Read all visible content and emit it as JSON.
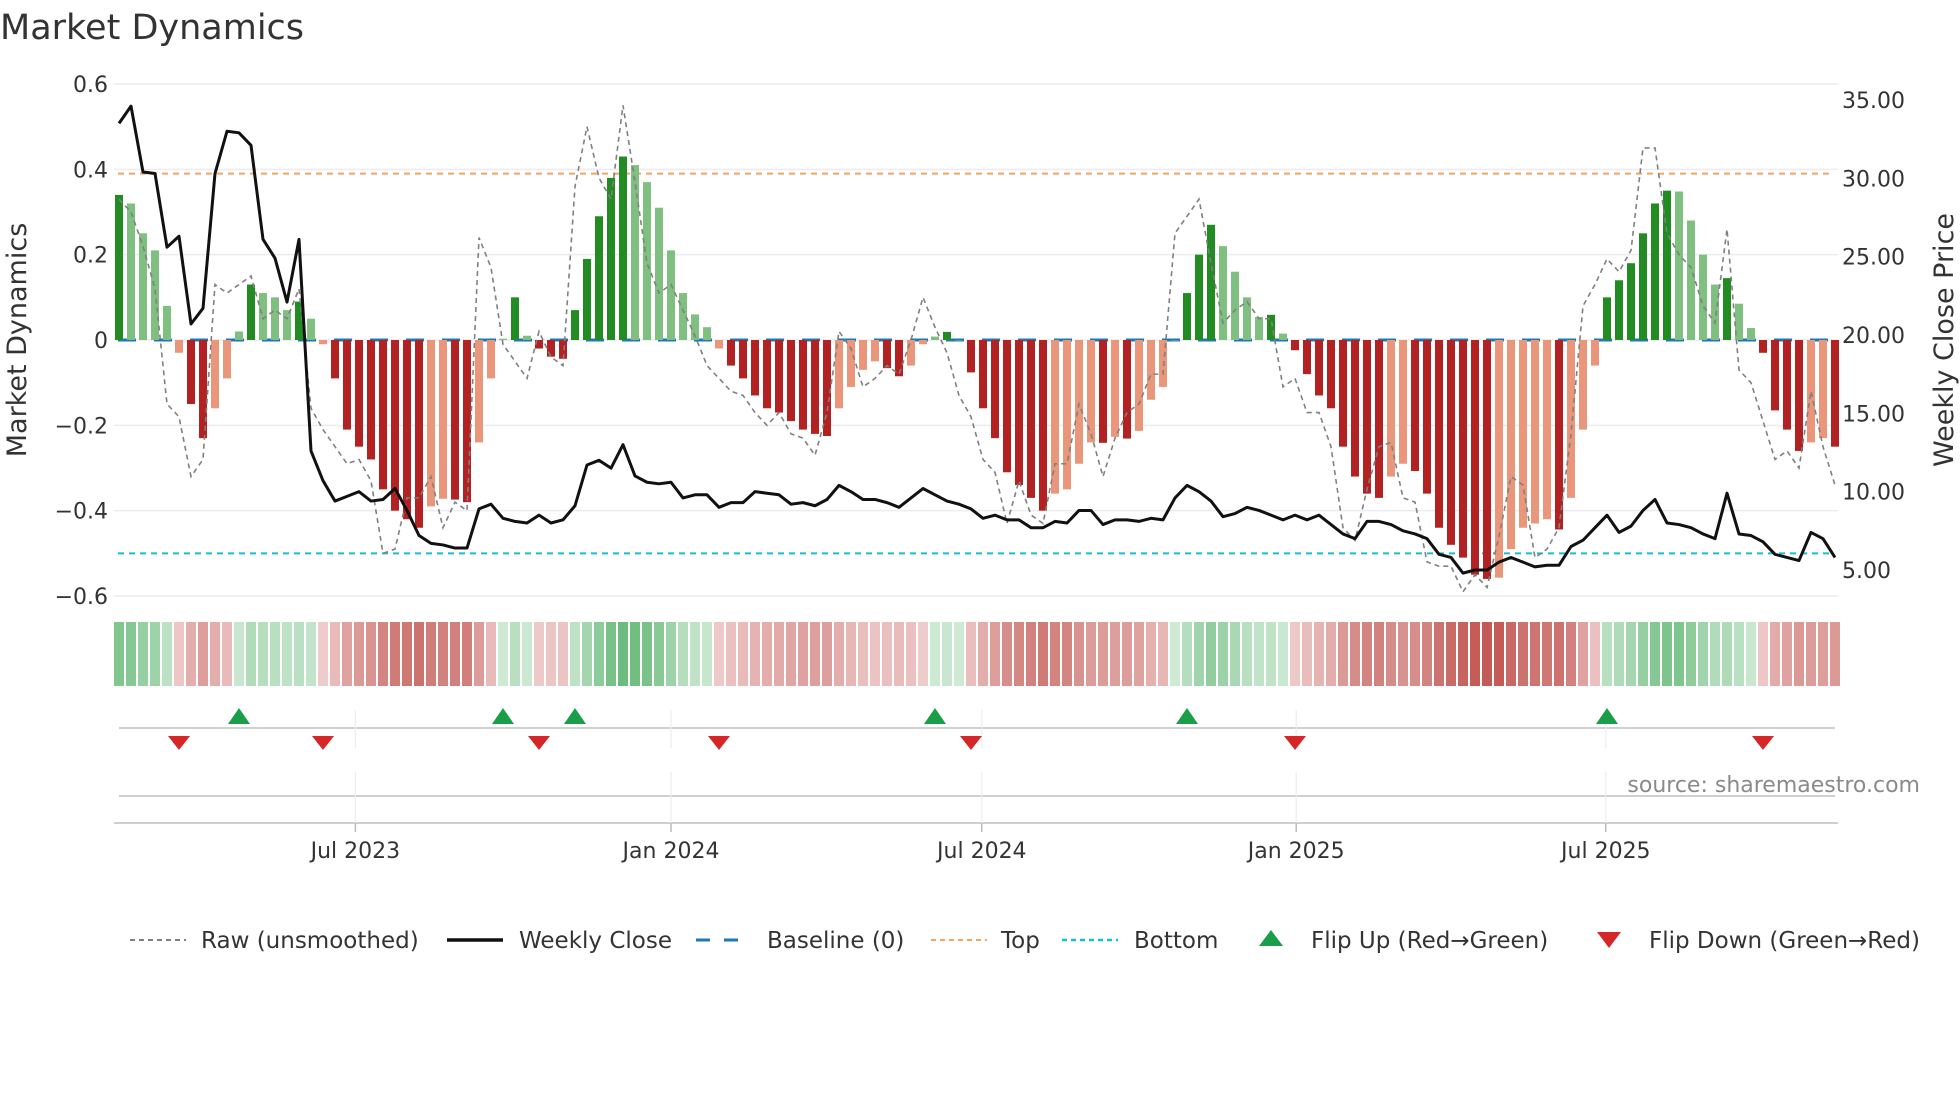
{
  "chart_data": {
    "type": "bar",
    "title": "Market Dynamics",
    "ylabel": "Market Dynamics",
    "y2label": "Weekly Close Price",
    "ylim": [
      -0.6,
      0.6
    ],
    "y2lim": [
      5,
      35
    ],
    "yticks": [
      "0.6",
      "0.4",
      "0.2",
      "0",
      "−0.2",
      "−0.4",
      "−0.6"
    ],
    "ytick_values": [
      0.6,
      0.4,
      0.2,
      0,
      -0.2,
      -0.4,
      -0.6
    ],
    "y2ticks": [
      "35.00",
      "30.00",
      "25.00",
      "20.00",
      "15.00",
      "10.00",
      "5.00"
    ],
    "y2tick_values": [
      35,
      30,
      25,
      20,
      15,
      10,
      5
    ],
    "x_unit": "week index",
    "xticks": [
      {
        "label": "Jul 2023",
        "week": 19.7
      },
      {
        "label": "Jan 2024",
        "week": 46.0
      },
      {
        "label": "Jul 2024",
        "week": 71.9
      },
      {
        "label": "Jan 2025",
        "week": 98.1
      },
      {
        "label": "Jul 2025",
        "week": 123.9
      }
    ],
    "top_level": 0.39,
    "bottom_level": -0.5,
    "baseline": 0,
    "grid": true,
    "legend_placement": "bottom",
    "source": "source: sharemaestro.com",
    "colors": {
      "up_strong": "#228b22",
      "up_fading": "#7fbf7f",
      "down_strong": "#b22222",
      "down_fading": "#e9967a",
      "raw": "#808080",
      "close": "#111111",
      "baseline": "#1f77b4",
      "top": "#f4a460",
      "bottom": "#17becf",
      "flip_up": "#1a9e4a",
      "flip_down": "#d62728"
    },
    "series": [
      {
        "name": "Market Dynamics (smoothed)",
        "values": [
          0.34,
          0.32,
          0.25,
          0.21,
          0.08,
          -0.03,
          -0.15,
          -0.23,
          -0.16,
          -0.09,
          0.02,
          0.13,
          0.11,
          0.1,
          0.07,
          0.09,
          0.05,
          -0.01,
          -0.09,
          -0.21,
          -0.25,
          -0.28,
          -0.35,
          -0.4,
          -0.42,
          -0.44,
          -0.39,
          -0.372,
          -0.374,
          -0.38,
          -0.24,
          -0.09,
          0.003,
          0.1,
          0.01,
          -0.02,
          -0.039,
          -0.044,
          0.07,
          0.19,
          0.29,
          0.38,
          0.43,
          0.41,
          0.37,
          0.31,
          0.21,
          0.11,
          0.06,
          0.03,
          -0.02,
          -0.06,
          -0.09,
          -0.13,
          -0.16,
          -0.17,
          -0.19,
          -0.21,
          -0.22,
          -0.225,
          -0.16,
          -0.11,
          -0.07,
          -0.05,
          -0.066,
          -0.085,
          -0.06,
          -0.01,
          0.008,
          0.019,
          0,
          -0.076,
          -0.16,
          -0.23,
          -0.31,
          -0.34,
          -0.37,
          -0.4,
          -0.36,
          -0.35,
          -0.29,
          -0.24,
          -0.241,
          -0.227,
          -0.231,
          -0.213,
          -0.14,
          -0.11,
          0,
          0.11,
          0.2,
          0.27,
          0.22,
          0.16,
          0.1,
          0.054,
          0.059,
          0.015,
          -0.024,
          -0.08,
          -0.13,
          -0.16,
          -0.25,
          -0.32,
          -0.36,
          -0.37,
          -0.32,
          -0.29,
          -0.307,
          -0.36,
          -0.44,
          -0.48,
          -0.51,
          -0.55,
          -0.56,
          -0.557,
          -0.49,
          -0.44,
          -0.43,
          -0.42,
          -0.444,
          -0.37,
          -0.21,
          -0.06,
          0.1,
          0.14,
          0.18,
          0.25,
          0.32,
          0.35,
          0.348,
          0.28,
          0.2,
          0.13,
          0.145,
          0.085,
          0.028,
          -0.03,
          -0.165,
          -0.21,
          -0.26,
          -0.24,
          -0.23,
          -0.25
        ]
      },
      {
        "name": "Raw (unsmoothed)",
        "values": [
          0.33,
          0.3,
          0.22,
          0.12,
          -0.15,
          -0.18,
          -0.32,
          -0.28,
          0.13,
          0.11,
          0.13,
          0.15,
          0.05,
          0.07,
          0.05,
          0.12,
          -0.16,
          -0.21,
          -0.25,
          -0.29,
          -0.28,
          -0.33,
          -0.5,
          -0.49,
          -0.37,
          -0.37,
          -0.32,
          -0.44,
          -0.38,
          -0.4,
          0.24,
          0.17,
          -0.01,
          -0.05,
          -0.09,
          0.02,
          -0.04,
          -0.06,
          0.36,
          0.5,
          0.38,
          0.33,
          0.55,
          0.37,
          0.18,
          0.11,
          0.13,
          0.07,
          0.01,
          -0.06,
          -0.09,
          -0.12,
          -0.13,
          -0.17,
          -0.2,
          -0.17,
          -0.22,
          -0.23,
          -0.27,
          -0.17,
          0.02,
          -0.02,
          -0.11,
          -0.09,
          -0.06,
          -0.08,
          0.0,
          0.1,
          0.03,
          -0.03,
          -0.13,
          -0.18,
          -0.28,
          -0.31,
          -0.43,
          -0.33,
          -0.41,
          -0.43,
          -0.29,
          -0.29,
          -0.15,
          -0.22,
          -0.32,
          -0.23,
          -0.17,
          -0.15,
          -0.08,
          -0.08,
          0.25,
          0.29,
          0.33,
          0.18,
          0.04,
          0.07,
          0.09,
          0.05,
          0.05,
          -0.11,
          -0.09,
          -0.17,
          -0.17,
          -0.25,
          -0.44,
          -0.47,
          -0.35,
          -0.25,
          -0.24,
          -0.37,
          -0.38,
          -0.52,
          -0.53,
          -0.53,
          -0.59,
          -0.55,
          -0.58,
          -0.46,
          -0.32,
          -0.34,
          -0.51,
          -0.49,
          -0.44,
          -0.22,
          0.08,
          0.13,
          0.19,
          0.16,
          0.21,
          0.45,
          0.45,
          0.25,
          0.2,
          0.17,
          0.08,
          0.04,
          0.26,
          -0.07,
          -0.1,
          -0.19,
          -0.28,
          -0.26,
          -0.3,
          -0.12,
          -0.25,
          -0.34
        ]
      },
      {
        "name": "Weekly Close",
        "axis": "right",
        "values": [
          33.5,
          34.6,
          30.4,
          30.3,
          25.6,
          26.3,
          20.7,
          21.7,
          30.3,
          33.0,
          32.9,
          32.1,
          26.1,
          24.9,
          22.1,
          26.1,
          12.6,
          10.7,
          9.4,
          9.7,
          10.0,
          9.4,
          9.5,
          10.2,
          8.8,
          7.2,
          6.7,
          6.6,
          6.4,
          6.4,
          8.9,
          9.2,
          8.3,
          8.1,
          8.0,
          8.5,
          8.0,
          8.2,
          9.1,
          11.7,
          12.0,
          11.5,
          13.0,
          11.0,
          10.6,
          10.5,
          10.6,
          9.6,
          9.8,
          9.8,
          9.0,
          9.3,
          9.3,
          10.0,
          9.9,
          9.8,
          9.2,
          9.3,
          9.1,
          9.5,
          10.4,
          10.0,
          9.5,
          9.5,
          9.3,
          9.0,
          9.6,
          10.2,
          9.8,
          9.4,
          9.2,
          8.9,
          8.3,
          8.5,
          8.2,
          8.2,
          7.7,
          7.7,
          8.1,
          8.0,
          8.8,
          8.8,
          7.9,
          8.2,
          8.2,
          8.1,
          8.3,
          8.2,
          9.6,
          10.4,
          10.0,
          9.4,
          8.4,
          8.6,
          9.0,
          8.8,
          8.5,
          8.2,
          8.5,
          8.2,
          8.5,
          7.9,
          7.3,
          7.0,
          8.1,
          8.1,
          7.9,
          7.5,
          7.3,
          7.0,
          6.0,
          5.8,
          4.8,
          5.0,
          5.0,
          5.5,
          5.8,
          5.5,
          5.2,
          5.3,
          5.3,
          6.5,
          6.9,
          7.7,
          8.5,
          7.4,
          7.8,
          8.8,
          9.5,
          8.0,
          7.9,
          7.7,
          7.3,
          7.0,
          9.9,
          7.3,
          7.2,
          6.8,
          6.0,
          5.8,
          5.6,
          7.4,
          7.0,
          5.8
        ]
      }
    ],
    "legend": [
      {
        "label": "Raw (unsmoothed)",
        "kind": "raw"
      },
      {
        "label": "Weekly Close",
        "kind": "close"
      },
      {
        "label": "Baseline (0)",
        "kind": "baseline"
      },
      {
        "label": "Top",
        "kind": "top"
      },
      {
        "label": "Bottom",
        "kind": "bottom"
      },
      {
        "label": "Flip Up (Red→Green)",
        "kind": "flip_up"
      },
      {
        "label": "Flip Down (Green→Red)",
        "kind": "flip_down"
      }
    ]
  }
}
